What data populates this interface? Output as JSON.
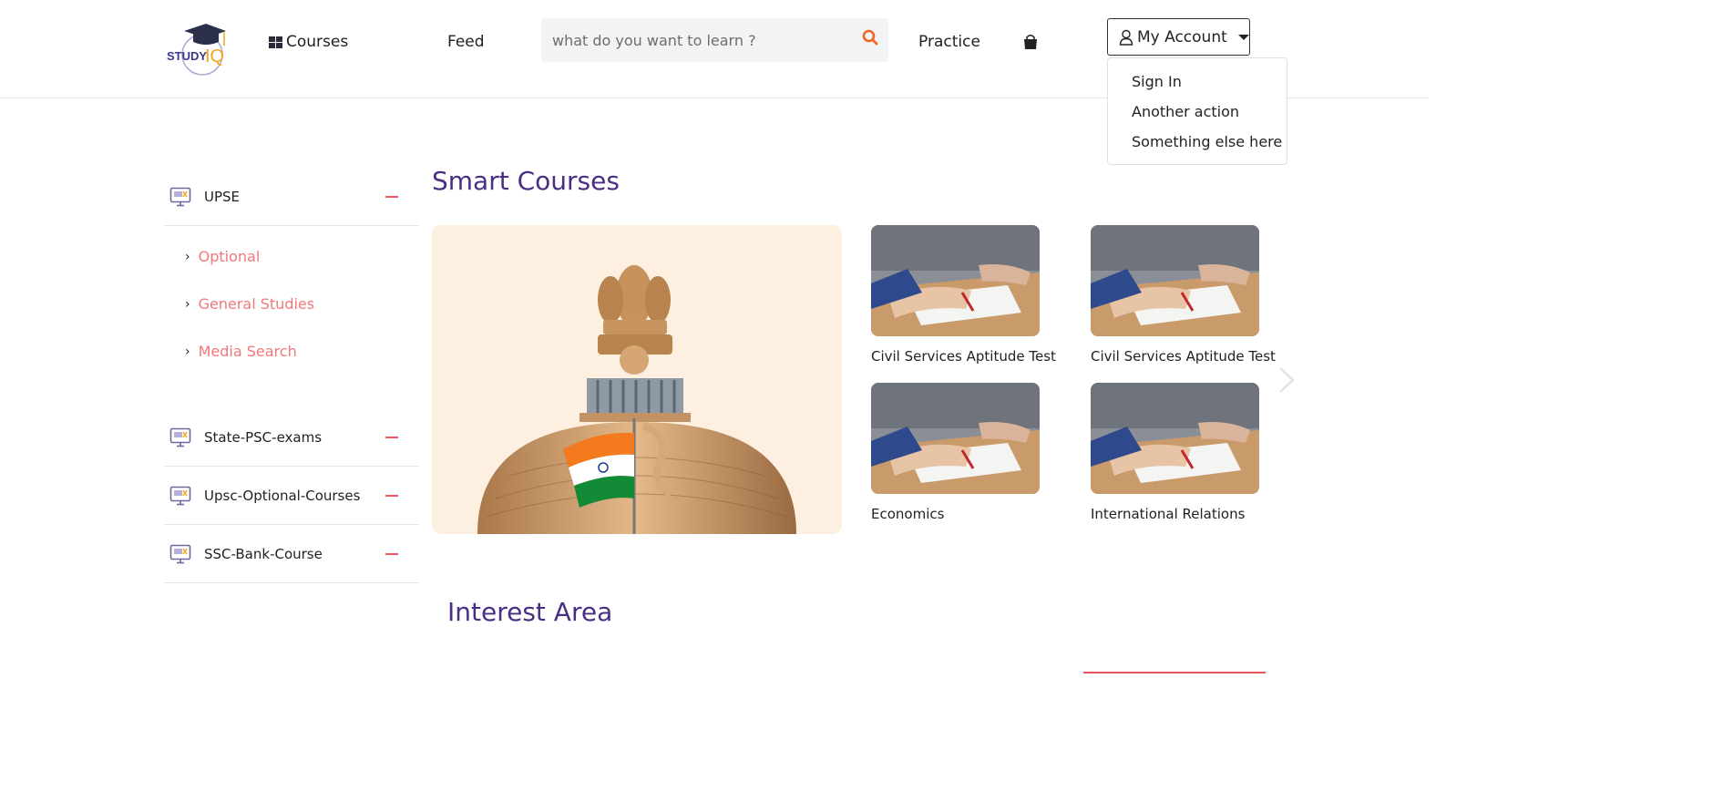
{
  "header": {
    "logo_text": "STUDY IQ",
    "nav": {
      "courses": "Courses",
      "feed": "Feed",
      "practice": "Practice"
    },
    "search": {
      "placeholder": "what do you want to learn ?"
    },
    "account": {
      "label": "My Account",
      "menu": [
        "Sign In",
        "Another action",
        "Something else here"
      ]
    }
  },
  "sidebar": {
    "categories": [
      {
        "label": "UPSE",
        "expanded": true,
        "subitems": [
          "Optional",
          "General Studies",
          "Media Search"
        ]
      },
      {
        "label": "State-PSC-exams"
      },
      {
        "label": "Upsc-Optional-Courses"
      },
      {
        "label": "SSC-Bank-Course"
      }
    ]
  },
  "main": {
    "smart_courses_title": "Smart Courses",
    "courses": [
      {
        "name": "Civil Services Aptitude Test"
      },
      {
        "name": "Civil Services Aptitude Test"
      },
      {
        "name": "Economics"
      },
      {
        "name": "International Relations"
      }
    ],
    "interest_title": "Interest Area"
  },
  "colors": {
    "accent": "#4b2e83",
    "link": "#f0787a",
    "minus": "#e8555c",
    "search_icon": "#f26522"
  },
  "icons": [
    "grid-icon",
    "search-icon",
    "shopping-bag-icon",
    "user-icon",
    "caret-down-icon",
    "monitor-course-icon",
    "chevron-right-icon",
    "next-arrow-icon"
  ]
}
